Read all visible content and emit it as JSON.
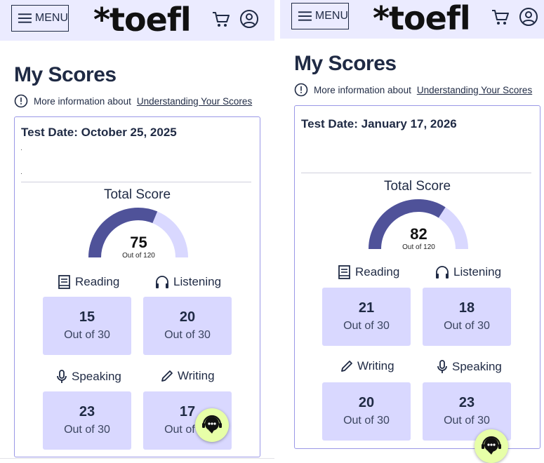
{
  "left": {
    "header": {
      "menu_label": "MENU",
      "logo_text": "*toefl",
      "cart_icon": "cart-icon",
      "user_icon": "user-icon"
    },
    "title": "My Scores",
    "info": {
      "prefix": "More information about",
      "link": "Understanding Your Scores"
    },
    "card": {
      "test_date": "Test Date: October 25, 2025",
      "total_label": "Total Score",
      "total_value": "75",
      "total_out": "Out of 120",
      "total_fraction": 0.625,
      "sections": [
        {
          "name": "Reading",
          "icon": "book-icon",
          "score": "15",
          "out": "Out of 30"
        },
        {
          "name": "Listening",
          "icon": "headphones-icon",
          "score": "20",
          "out": "Out of 30"
        },
        {
          "name": "Speaking",
          "icon": "microphone-icon",
          "score": "23",
          "out": "Out of 30"
        },
        {
          "name": "Writing",
          "icon": "pencil-icon",
          "score": "17",
          "out": "Out of 30"
        }
      ]
    }
  },
  "right": {
    "header": {
      "menu_label": "MENU",
      "logo_text": "*toefl",
      "cart_icon": "cart-icon",
      "user_icon": "user-icon"
    },
    "title": "My Scores",
    "info": {
      "prefix": "More information about",
      "link": "Understanding Your Scores"
    },
    "card": {
      "test_date": "Test Date: January 17, 2026",
      "total_label": "Total Score",
      "total_value": "82",
      "total_out": "Out of 120",
      "total_fraction": 0.683,
      "sections": [
        {
          "name": "Reading",
          "icon": "book-icon",
          "score": "21",
          "out": "Out of 30"
        },
        {
          "name": "Listening",
          "icon": "headphones-icon",
          "score": "18",
          "out": "Out of 30"
        },
        {
          "name": "Writing",
          "icon": "pencil-icon",
          "score": "20",
          "out": "Out of 30"
        },
        {
          "name": "Speaking",
          "icon": "microphone-icon",
          "score": "23",
          "out": "Out of 30"
        }
      ]
    }
  },
  "colors": {
    "header_bg": "#ebebff",
    "tile_bg": "#d9d8ff",
    "gauge_fill": "#4f5299",
    "gauge_track": "#d9d8ff",
    "chat_bg": "#e7ffa8"
  }
}
